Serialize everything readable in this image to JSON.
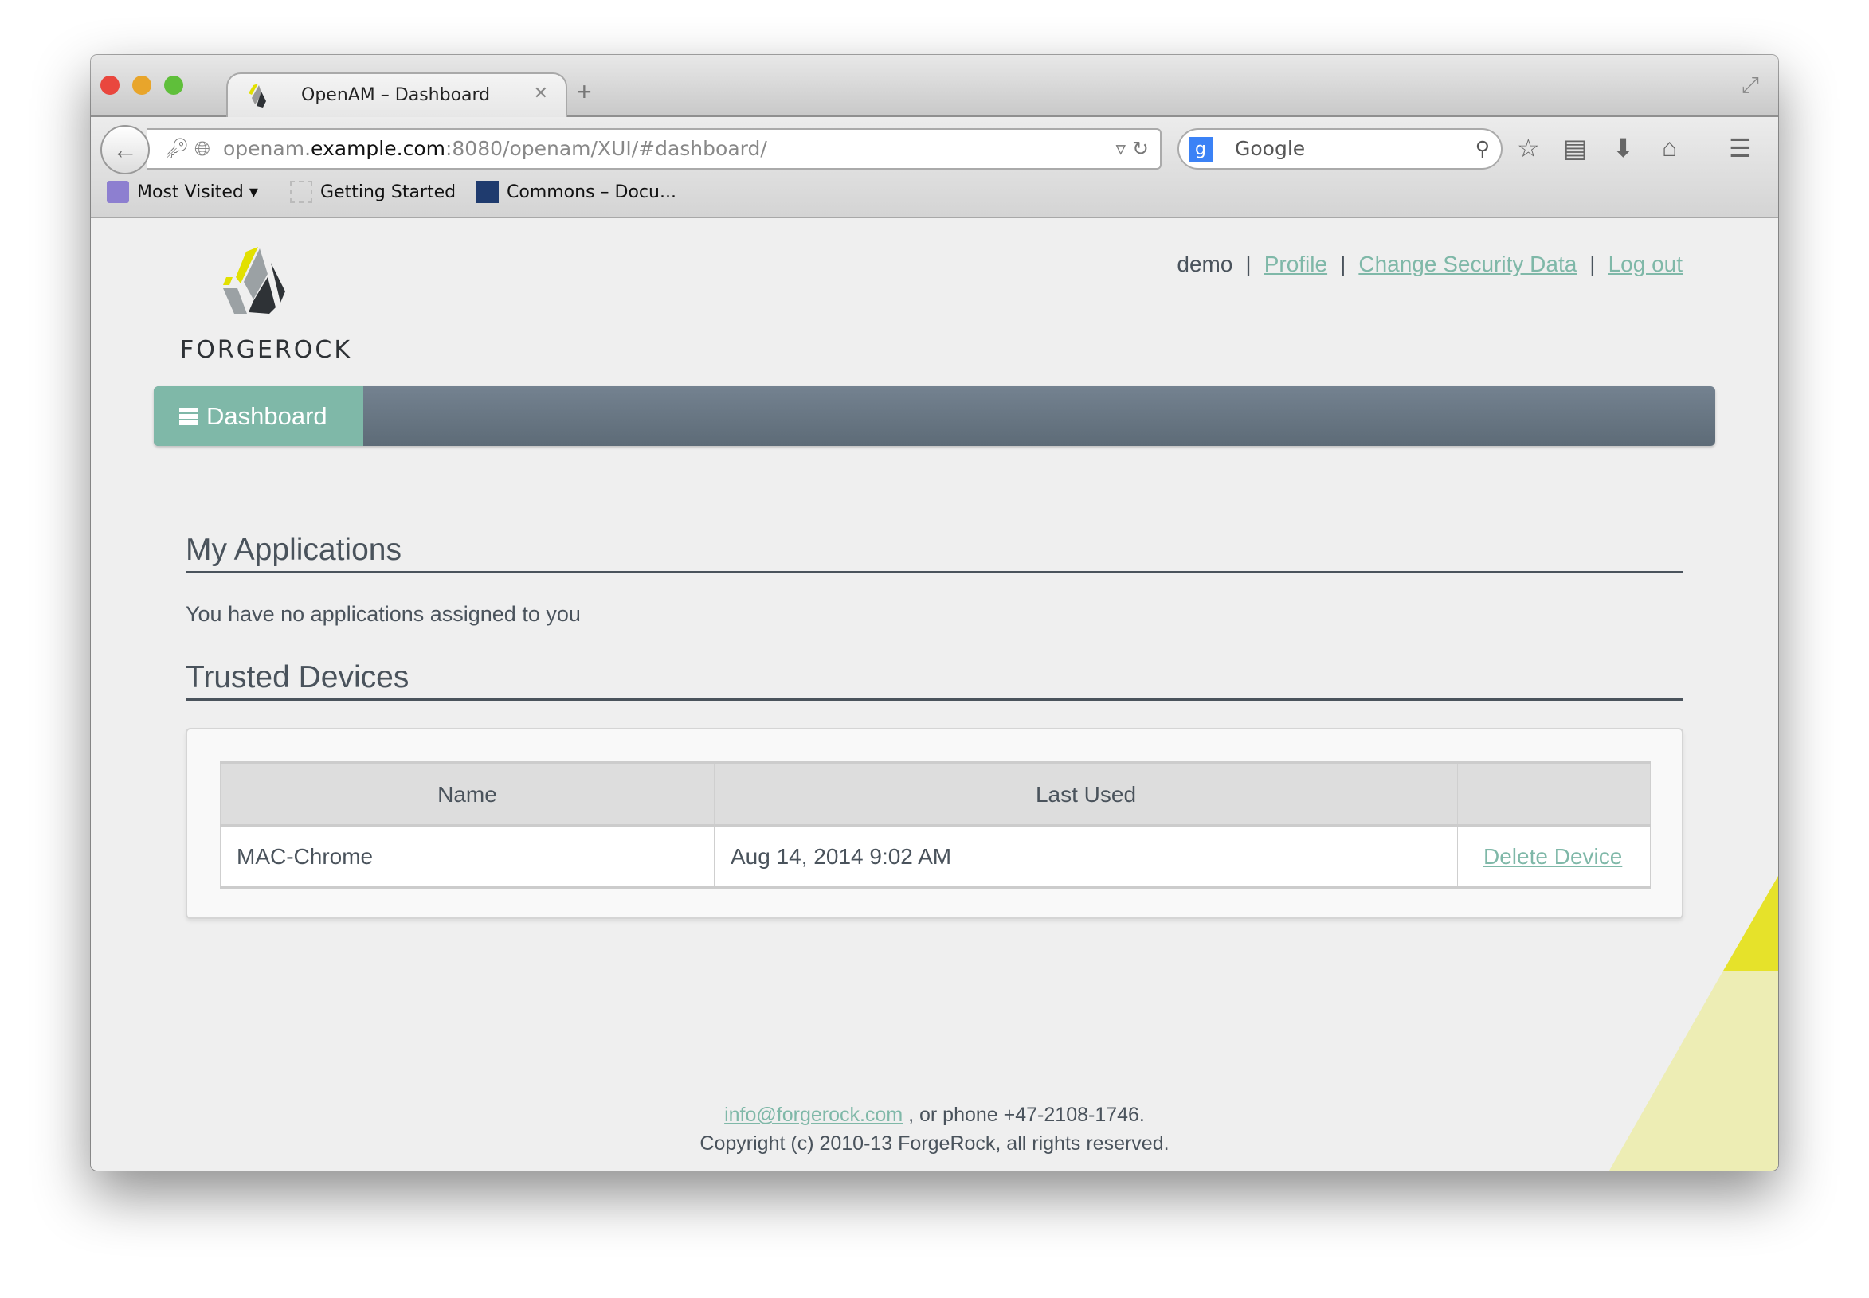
{
  "browser": {
    "tab_title": "OpenAM – Dashboard",
    "new_tab": "+",
    "url_prefix": "openam.",
    "url_domain": "example.com",
    "url_suffix": ":8080/openam/XUI/#dashboard/",
    "search_placeholder": "Google",
    "bookmarks": [
      {
        "label": "Most Visited ▾"
      },
      {
        "label": "Getting Started"
      },
      {
        "label": "Commons – Docu..."
      }
    ]
  },
  "header": {
    "brand": "FORGEROCK",
    "username": "demo",
    "links": [
      {
        "label": "Profile"
      },
      {
        "label": "Change Security Data"
      },
      {
        "label": "Log out"
      }
    ]
  },
  "nav": {
    "dashboard_label": "Dashboard"
  },
  "applications": {
    "title": "My Applications",
    "empty_message": "You have no applications assigned to you"
  },
  "devices": {
    "title": "Trusted Devices",
    "columns": [
      "Name",
      "Last Used",
      ""
    ],
    "rows": [
      {
        "name": "MAC-Chrome",
        "last_used": "Aug 14, 2014 9:02 AM",
        "action": "Delete Device"
      }
    ]
  },
  "footer": {
    "email": "info@forgerock.com",
    "phone_text": " , or phone +47-2108-1746.",
    "copyright": "Copyright (c) 2010-13 ForgeRock, all rights reserved."
  },
  "colors": {
    "accent": "#7fb8a8",
    "nav": "#6a7884",
    "text": "#4a535c",
    "yellow": "#e2e000"
  }
}
